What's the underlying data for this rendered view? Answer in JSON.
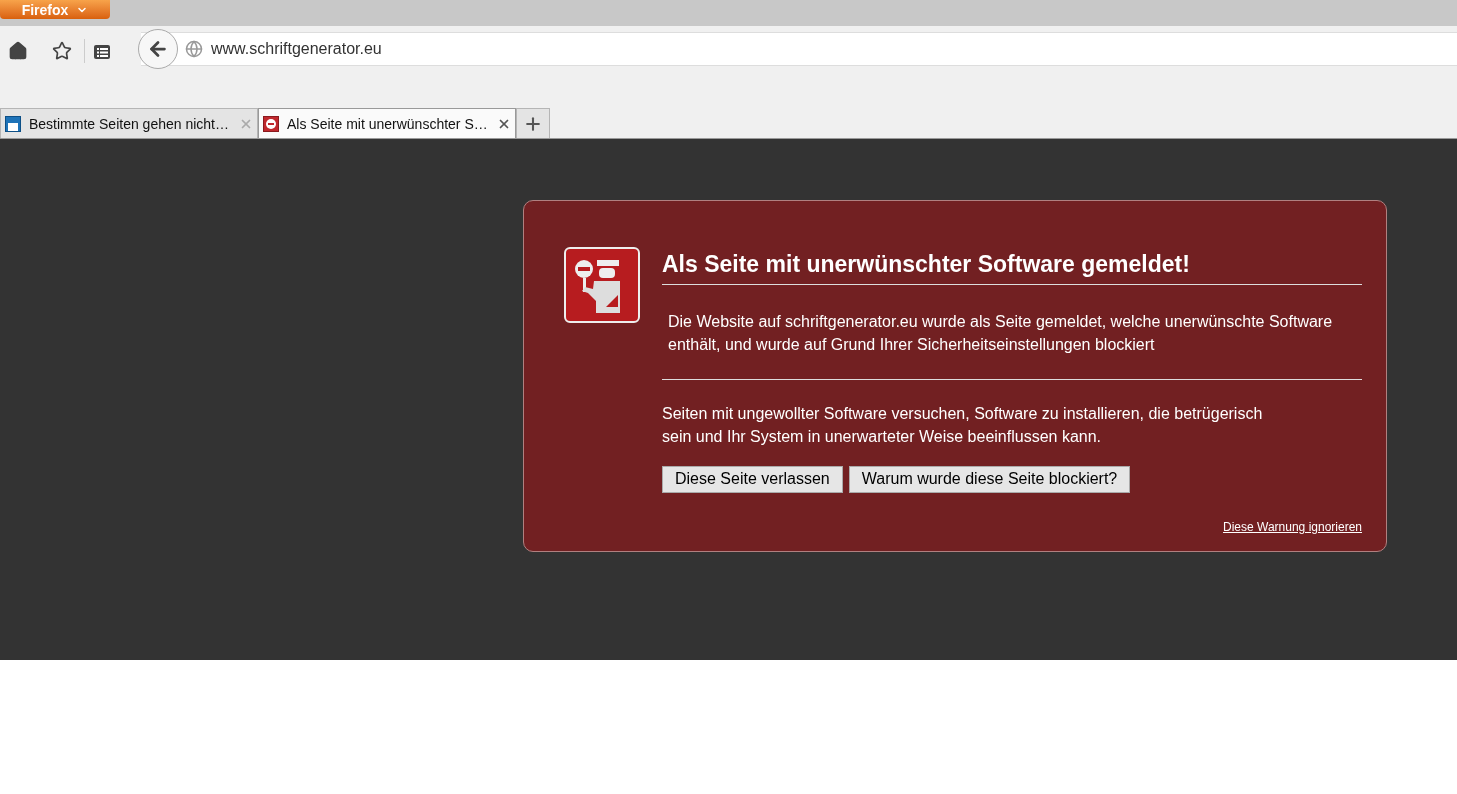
{
  "app_menu": {
    "label": "Firefox"
  },
  "address_bar": {
    "url": "www.schriftgenerator.eu"
  },
  "tabs": [
    {
      "title": "Bestimmte Seiten gehen nicht…",
      "selected": false,
      "kind": "page"
    },
    {
      "title": "Als Seite mit unerwünschter S…",
      "selected": true,
      "kind": "blocked"
    }
  ],
  "warning": {
    "title": "Als Seite mit unerwünschter Software gemeldet!",
    "description": "Die Website auf schriftgenerator.eu wurde als Seite gemeldet, welche unerwünschte Software enthält, und wurde auf Grund Ihrer Sicherheitseinstellungen blockiert",
    "explanation": "Seiten mit ungewollter Software versuchen, Software zu installieren, die betrügerisch sein und Ihr System in unerwarteter Weise beeinflussen kann.",
    "buttons": [
      "Diese Seite verlassen",
      "Warum wurde diese Seite blockiert?"
    ],
    "ignore_link": "Diese Warnung ignorieren"
  }
}
